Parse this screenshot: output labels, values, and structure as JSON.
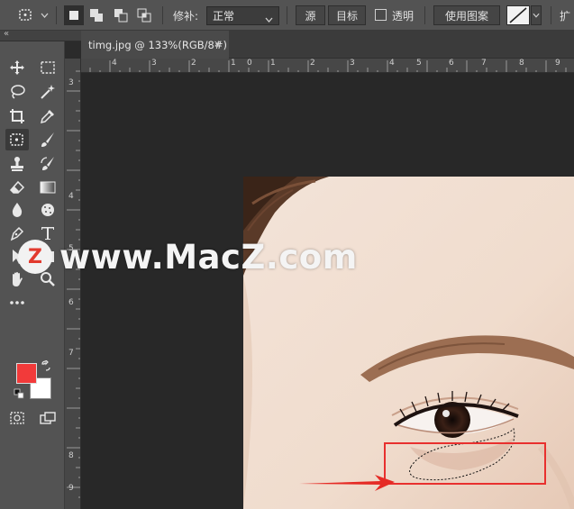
{
  "options_bar": {
    "patch_label": "修补:",
    "patch_mode": "正常",
    "source_label": "源",
    "target_label": "目标",
    "transparent_label": "透明",
    "use_pattern_label": "使用图案",
    "diffusion_label": "扩"
  },
  "document": {
    "tab_title": "timg.jpg @ 133%(RGB/8#)",
    "close_symbol": "×"
  },
  "rulers": {
    "horizontal": [
      "4",
      "3",
      "2",
      "1",
      "0",
      "1",
      "2",
      "3",
      "4",
      "5",
      "6",
      "7",
      "8",
      "9"
    ],
    "vertical": [
      "3",
      "4",
      "5",
      "6",
      "7",
      "8",
      "9"
    ]
  },
  "colors": {
    "foreground": "#f23a3a",
    "background": "#ffffff",
    "highlight_box": "#e8302e"
  },
  "watermark": {
    "logo_letter": "Z",
    "text": "www.MacZ.com"
  }
}
